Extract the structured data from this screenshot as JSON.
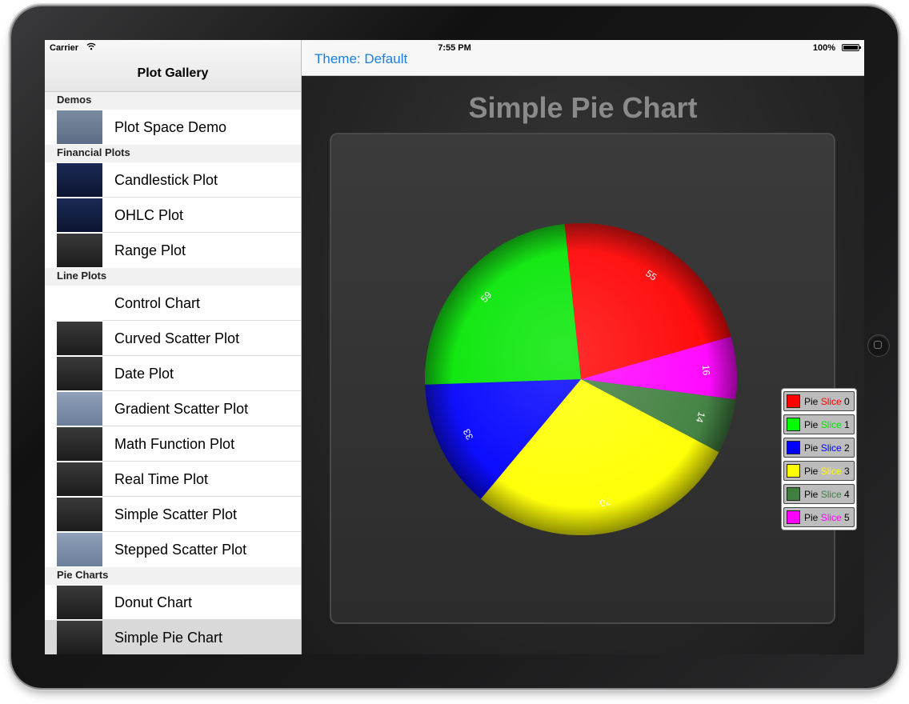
{
  "status_bar": {
    "carrier": "Carrier",
    "wifi_icon": "wifi-icon",
    "time": "7:55 PM",
    "battery": "100%"
  },
  "sidebar": {
    "title": "Plot Gallery",
    "sections": [
      {
        "header": "Demos",
        "items": [
          {
            "label": "Plot Space Demo",
            "thumb": "light"
          }
        ]
      },
      {
        "header": "Financial Plots",
        "items": [
          {
            "label": "Candlestick Plot",
            "thumb": "navy"
          },
          {
            "label": "OHLC Plot",
            "thumb": "navy"
          },
          {
            "label": "Range Plot",
            "thumb": "dark"
          }
        ]
      },
      {
        "header": "Line Plots",
        "items": [
          {
            "label": "Control Chart",
            "thumb": "white"
          },
          {
            "label": "Curved Scatter Plot",
            "thumb": "dark"
          },
          {
            "label": "Date Plot",
            "thumb": "dark"
          },
          {
            "label": "Gradient Scatter Plot",
            "thumb": "gray-blue"
          },
          {
            "label": "Math Function Plot",
            "thumb": "dark"
          },
          {
            "label": "Real Time Plot",
            "thumb": "dark"
          },
          {
            "label": "Simple Scatter Plot",
            "thumb": "dark"
          },
          {
            "label": "Stepped Scatter Plot",
            "thumb": "gray-blue"
          }
        ]
      },
      {
        "header": "Pie Charts",
        "items": [
          {
            "label": "Donut Chart",
            "thumb": "dark"
          },
          {
            "label": "Simple Pie Chart",
            "thumb": "dark",
            "selected": true
          }
        ]
      }
    ]
  },
  "detail": {
    "theme_button": "Theme: Default"
  },
  "chart_data": {
    "type": "pie",
    "title": "Simple Pie Chart",
    "values": [
      55,
      16,
      14,
      70,
      33,
      59
    ],
    "slice_order_clockwise_from_top": [
      "Pie Slice 0",
      "Pie Slice 5",
      "Pie Slice 4",
      "Pie Slice 3",
      "Pie Slice 2",
      "Pie Slice 1"
    ],
    "slices": [
      {
        "label": "Pie Slice 0",
        "value": 55,
        "color": "#ff0000"
      },
      {
        "label": "Pie Slice 1",
        "value": 59,
        "color": "#00e600"
      },
      {
        "label": "Pie Slice 2",
        "value": 33,
        "color": "#0000ff"
      },
      {
        "label": "Pie Slice 3",
        "value": 70,
        "color": "#ffff00"
      },
      {
        "label": "Pie Slice 4",
        "value": 14,
        "color": "#3f7f3f"
      },
      {
        "label": "Pie Slice 5",
        "value": 16,
        "color": "#ff00ff"
      }
    ],
    "legend": {
      "placement": "right",
      "items": [
        {
          "prefix": "Pie",
          "word": "Slice",
          "num": "0",
          "word_color": "#ff0000",
          "swatch": "#ff0000"
        },
        {
          "prefix": "Pie",
          "word": "Slice",
          "num": "1",
          "word_color": "#00e600",
          "swatch": "#00ff00"
        },
        {
          "prefix": "Pie",
          "word": "Slice",
          "num": "2",
          "word_color": "#0000ff",
          "swatch": "#0000ff"
        },
        {
          "prefix": "Pie",
          "word": "Slice",
          "num": "3",
          "word_color": "#ffff00",
          "swatch": "#ffff00"
        },
        {
          "prefix": "Pie",
          "word": "Slice",
          "num": "4",
          "word_color": "#3f7f3f",
          "swatch": "#3f7f3f"
        },
        {
          "prefix": "Pie",
          "word": "Slice",
          "num": "5",
          "word_color": "#ff00ff",
          "swatch": "#ff00ff"
        }
      ]
    }
  }
}
